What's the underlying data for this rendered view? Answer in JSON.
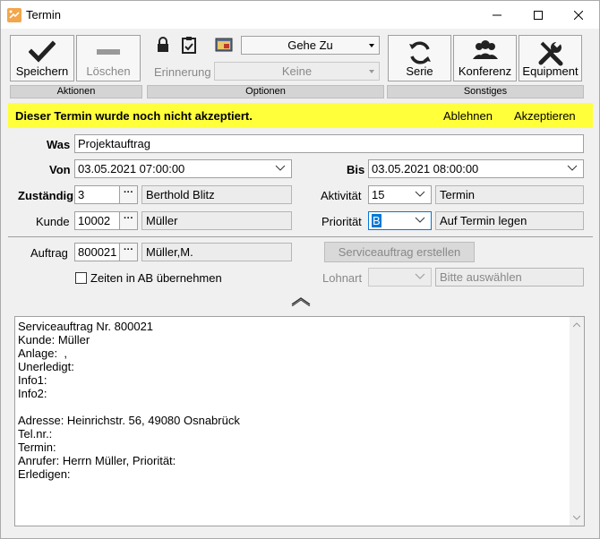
{
  "window": {
    "title": "Termin"
  },
  "toolbar": {
    "save_label": "Speichern",
    "delete_label": "Löschen",
    "reminder_label": "Erinnerung",
    "goto_label": "Gehe Zu",
    "reminder_value": "Keine",
    "series_label": "Serie",
    "conference_label": "Konferenz",
    "equipment_label": "Equipment",
    "group_actions": "Aktionen",
    "group_options": "Optionen",
    "group_misc": "Sonstiges"
  },
  "banner": {
    "message": "Dieser Termin wurde noch nicht akzeptiert.",
    "decline": "Ablehnen",
    "accept": "Akzeptieren",
    "color": "#ffff3a"
  },
  "form": {
    "was_label": "Was",
    "was_value": "Projektauftrag",
    "von_label": "Von",
    "von_value": "03.05.2021 07:00:00",
    "bis_label": "Bis",
    "bis_value": "03.05.2021 08:00:00",
    "zustaendig_label": "Zuständig",
    "zustaendig_id": "3",
    "zustaendig_name": "Berthold Blitz",
    "aktivitaet_label": "Aktivität",
    "aktivitaet_id": "15",
    "aktivitaet_name": "Termin",
    "kunde_label": "Kunde",
    "kunde_id": "10002",
    "kunde_name": "Müller",
    "prioritaet_label": "Priorität",
    "prioritaet_value": "B",
    "prioritaet_name": "Auf Termin legen",
    "auftrag_label": "Auftrag",
    "auftrag_id": "800021",
    "auftrag_name": "Müller,M.",
    "serviceauftrag_button": "Serviceauftrag erstellen",
    "zeiten_checkbox": "Zeiten in AB übernehmen",
    "lohnart_label": "Lohnart",
    "lohnart_placeholder": "Bitte auswählen",
    "ellipsis": "···"
  },
  "memo": {
    "lines": [
      "Serviceauftrag Nr. 800021",
      "Kunde: Müller",
      "Anlage:  ,",
      "Unerledigt:",
      "Info1:",
      "Info2:",
      "",
      "Adresse: Heinrichstr. 56, 49080 Osnabrück",
      "Tel.nr.:",
      "Termin:",
      "Anrufer: Herrn Müller, Priorität:",
      "Erledigen:"
    ]
  },
  "icons": {
    "app": "app-icon",
    "minimize": "minimize-icon",
    "maximize": "maximize-icon",
    "close": "close-icon",
    "save": "checkmark-icon",
    "delete": "minus-icon",
    "lock": "lock-icon",
    "clipboard": "clipboard-icon",
    "calendar": "calendar-image-icon",
    "series": "refresh-icon",
    "conference": "people-icon",
    "equipment": "tools-icon",
    "collapse": "chevron-up-icon"
  }
}
